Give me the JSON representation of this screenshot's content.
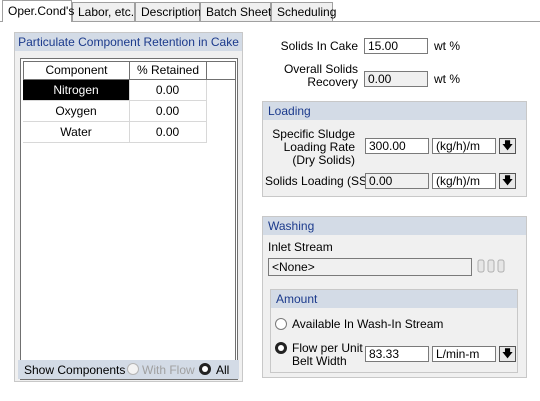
{
  "tabs": [
    {
      "label": "Oper.Cond's"
    },
    {
      "label": "Labor, etc."
    },
    {
      "label": "Description"
    },
    {
      "label": "Batch Sheet"
    },
    {
      "label": "Scheduling"
    }
  ],
  "retention": {
    "title": "Particulate Component Retention in Cake",
    "columns": [
      "Component",
      "% Retained"
    ],
    "rows": [
      {
        "component": "Nitrogen",
        "retained": "0.00"
      },
      {
        "component": "Oxygen",
        "retained": "0.00"
      },
      {
        "component": "Water",
        "retained": "0.00"
      }
    ],
    "show_components": {
      "label": "Show Components",
      "with_flow": "With Flow",
      "all": "All",
      "selected": "All"
    }
  },
  "solids": {
    "solids_in_cake_label": "Solids In Cake",
    "solids_in_cake_value": "15.00",
    "solids_in_cake_unit": "wt %",
    "overall_recovery_label_1": "Overall Solids",
    "overall_recovery_label_2": "Recovery",
    "overall_recovery_value": "0.00",
    "overall_recovery_unit": "wt %"
  },
  "loading": {
    "title": "Loading",
    "sludge_label_1": "Specific Sludge",
    "sludge_label_2": "Loading Rate",
    "sludge_label_3": "(Dry Solids)",
    "sludge_value": "300.00",
    "sludge_unit": "(kg/h)/m",
    "ss_label": "Solids Loading (SS)",
    "ss_value": "0.00",
    "ss_unit": "(kg/h)/m"
  },
  "washing": {
    "title": "Washing",
    "inlet_label": "Inlet Stream",
    "inlet_value": "<None>",
    "amount_title": "Amount",
    "option_available": "Available In Wash-In Stream",
    "option_flow_1": "Flow per Unit",
    "option_flow_2": "Belt Width",
    "flow_value": "83.33",
    "flow_unit": "L/min-m",
    "selected": "Flow per Unit Belt Width"
  },
  "icons": {
    "dropdown": "down-arrow-icon",
    "stream": "stream-tubes-icon"
  },
  "colors": {
    "header_bg": "#d3dbe6",
    "header_text": "#1b3a8c",
    "panel_bg": "#f0f0f0",
    "selected_cell": "#000000"
  }
}
